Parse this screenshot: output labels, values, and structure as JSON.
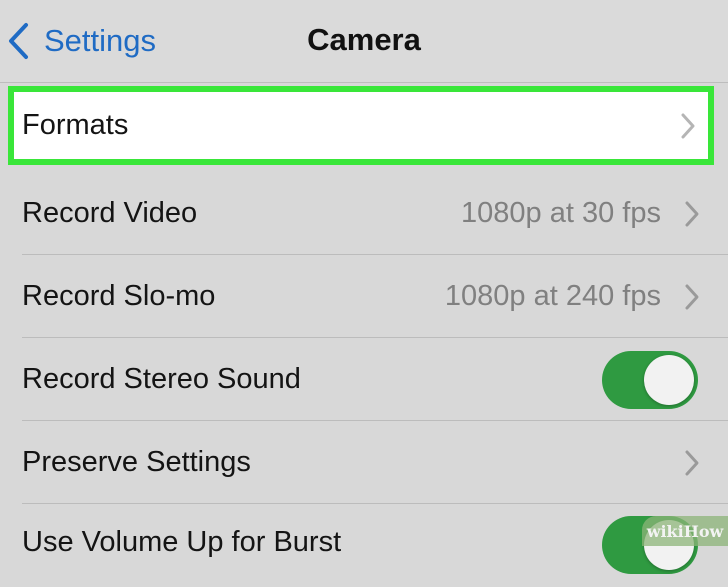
{
  "nav": {
    "back_label": "Settings",
    "title": "Camera"
  },
  "rows": [
    {
      "label": "Formats",
      "value": ""
    },
    {
      "label": "Record Video",
      "value": "1080p at 30 fps"
    },
    {
      "label": "Record Slo-mo",
      "value": "1080p at 240 fps"
    },
    {
      "label": "Record Stereo Sound",
      "value": "",
      "toggle_on": true
    },
    {
      "label": "Preserve Settings",
      "value": ""
    },
    {
      "label": "Use Volume Up for Burst",
      "value": "",
      "toggle_on": true
    }
  ],
  "colors": {
    "highlight": "#39e639",
    "toggle_on": "#2f9a41",
    "link": "#1f6bc4"
  },
  "watermark": "wikiHow"
}
